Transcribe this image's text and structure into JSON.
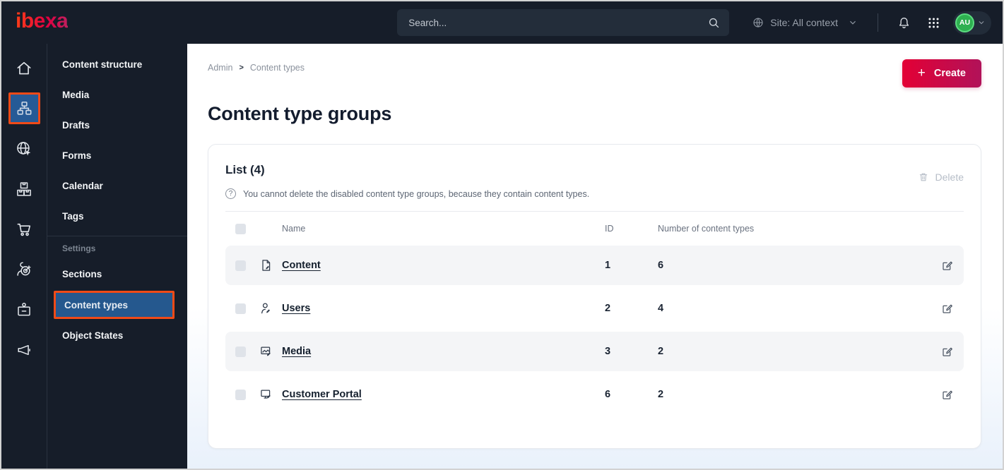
{
  "colors": {
    "topbar_bg": "#161d29",
    "accent_orange": "#f04a17",
    "active_blue": "#265a96",
    "create_gradient_start": "#e30035",
    "create_gradient_end": "#b11259",
    "avatar_green": "#2eb050",
    "link_dark": "#15202e"
  },
  "topbar": {
    "logo": "ibexa",
    "search_placeholder": "Search...",
    "site_context": "Site: All context",
    "avatar_initials": "AU",
    "icons": [
      "globe-icon",
      "chevron-down-icon",
      "bell-icon",
      "app-grid-icon",
      "search-icon"
    ]
  },
  "icon_rail": {
    "items": [
      {
        "icon": "home-icon",
        "active": false
      },
      {
        "icon": "sitemap-icon",
        "active": true
      },
      {
        "icon": "globe-pointer-icon",
        "active": false
      },
      {
        "icon": "packages-icon",
        "active": false
      },
      {
        "icon": "cart-icon",
        "active": false
      },
      {
        "icon": "audience-target-icon",
        "active": false
      },
      {
        "icon": "id-badge-icon",
        "active": false
      },
      {
        "icon": "megaphone-icon",
        "active": false
      }
    ]
  },
  "sidebar": {
    "items": [
      "Content structure",
      "Media",
      "Drafts",
      "Forms",
      "Calendar",
      "Tags"
    ],
    "section_label": "Settings",
    "settings_items": [
      "Sections",
      "Content types",
      "Object States"
    ],
    "active_item": "Content types"
  },
  "main": {
    "breadcrumb": {
      "parent": "Admin",
      "separator": ">",
      "current": "Content types"
    },
    "create_plus": "+",
    "create_label": "Create",
    "title": "Content type groups",
    "card": {
      "list_title": "List (4)",
      "help_glyph": "?",
      "info": "You cannot delete the disabled content type groups, because they contain content types.",
      "delete_label": "Delete",
      "table": {
        "headers": {
          "name": "Name",
          "id": "ID",
          "count": "Number of content types"
        },
        "rows": [
          {
            "icon": "file-edit-icon",
            "name": "Content",
            "id": "1",
            "count": "6"
          },
          {
            "icon": "user-edit-icon",
            "name": "Users",
            "id": "2",
            "count": "4"
          },
          {
            "icon": "image-edit-icon",
            "name": "Media",
            "id": "3",
            "count": "2"
          },
          {
            "icon": "monitor-edit-icon",
            "name": "Customer Portal",
            "id": "6",
            "count": "2"
          }
        ]
      }
    }
  }
}
